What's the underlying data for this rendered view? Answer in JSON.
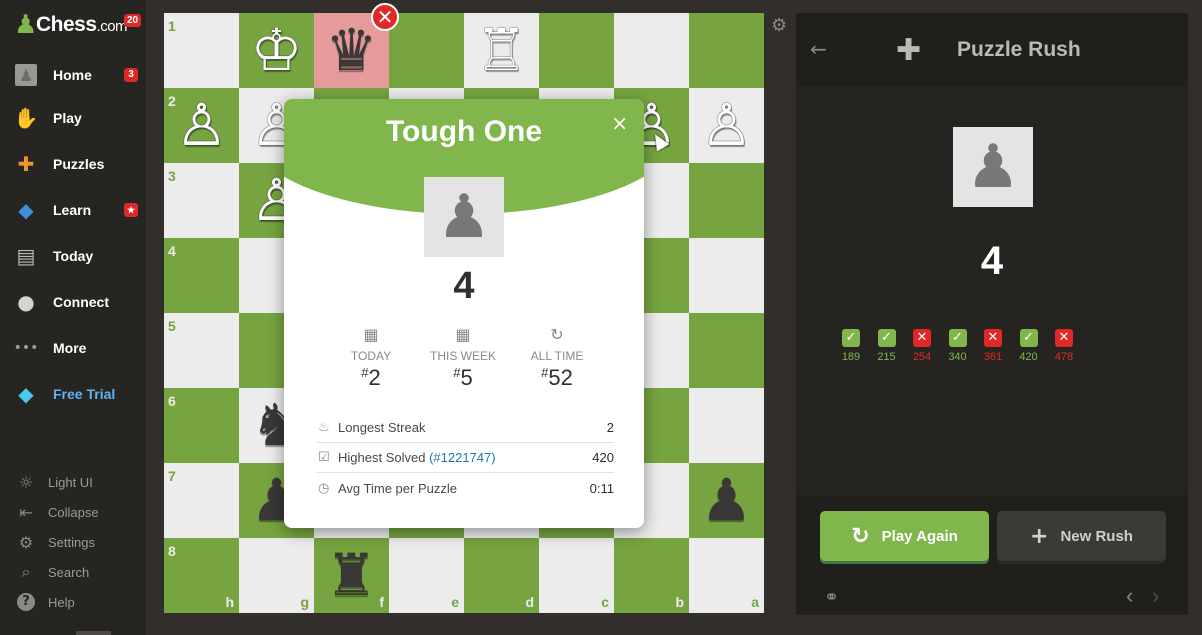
{
  "sidebar": {
    "logo": {
      "text": "Chess",
      "suffix": ".com",
      "badge": "20"
    },
    "nav": [
      {
        "label": "Home",
        "icon": "home-avatar-icon",
        "badge": "3"
      },
      {
        "label": "Play",
        "icon": "play-hand-icon"
      },
      {
        "label": "Puzzles",
        "icon": "puzzle-icon"
      },
      {
        "label": "Learn",
        "icon": "learn-cap-icon",
        "badge": "★"
      },
      {
        "label": "Today",
        "icon": "newspaper-icon"
      },
      {
        "label": "Connect",
        "icon": "chat-icon"
      },
      {
        "label": "More",
        "icon": "dots-icon"
      },
      {
        "label": "Free Trial",
        "icon": "diamond-icon"
      }
    ],
    "footer": [
      {
        "label": "Light UI",
        "icon": "sun-icon"
      },
      {
        "label": "Collapse",
        "icon": "collapse-icon"
      },
      {
        "label": "Settings",
        "icon": "gear-icon"
      },
      {
        "label": "Search",
        "icon": "search-icon"
      },
      {
        "label": "Help",
        "icon": "help-icon"
      }
    ]
  },
  "board": {
    "ranks": [
      "1",
      "2",
      "3",
      "4",
      "5",
      "6",
      "7",
      "8"
    ],
    "files": [
      "h",
      "g",
      "f",
      "e",
      "d",
      "c",
      "b",
      "a"
    ],
    "colors": {
      "light": "#ececec",
      "dark": "#76a440",
      "highlight": "#e49b99"
    },
    "pieces": [
      {
        "sq": "g1",
        "glyph": "♔",
        "side": "w"
      },
      {
        "sq": "f1",
        "glyph": "♛",
        "side": "b"
      },
      {
        "sq": "d1",
        "glyph": "♖",
        "side": "w"
      },
      {
        "sq": "h2",
        "glyph": "♙",
        "side": "w"
      },
      {
        "sq": "g2",
        "glyph": "♙",
        "side": "w"
      },
      {
        "sq": "b2",
        "glyph": "♙",
        "side": "w"
      },
      {
        "sq": "a2",
        "glyph": "♙",
        "side": "w"
      },
      {
        "sq": "g3",
        "glyph": "♙",
        "side": "w"
      },
      {
        "sq": "g6",
        "glyph": "♞",
        "side": "b"
      },
      {
        "sq": "g7",
        "glyph": "♟",
        "side": "b"
      },
      {
        "sq": "a7",
        "glyph": "♟",
        "side": "b"
      },
      {
        "sq": "f8",
        "glyph": "♜",
        "side": "b"
      }
    ]
  },
  "modal": {
    "title": "Tough One",
    "close": "×",
    "score": "4",
    "stats": [
      {
        "label": "TODAY",
        "value": "2",
        "icon": "calendar-icon"
      },
      {
        "label": "THIS WEEK",
        "value": "5",
        "icon": "calendar-icon"
      },
      {
        "label": "ALL TIME",
        "value": "52",
        "icon": "refresh-icon"
      }
    ],
    "hash": "#",
    "rows": [
      {
        "label": "Longest Streak",
        "value": "2",
        "icon": "flame-icon"
      },
      {
        "label": "Highest Solved",
        "link": "(#1221747)",
        "value": "420",
        "icon": "check-square-icon"
      },
      {
        "label": "Avg Time per Puzzle",
        "value": "0:11",
        "icon": "clock-icon"
      }
    ]
  },
  "panel": {
    "title": "Puzzle Rush",
    "score": "4",
    "results": [
      {
        "value": "189",
        "ok": true
      },
      {
        "value": "215",
        "ok": true
      },
      {
        "value": "254",
        "ok": false
      },
      {
        "value": "340",
        "ok": true
      },
      {
        "value": "361",
        "ok": false
      },
      {
        "value": "420",
        "ok": true
      },
      {
        "value": "478",
        "ok": false
      }
    ],
    "play_again": "Play Again",
    "new_rush": "New Rush"
  }
}
